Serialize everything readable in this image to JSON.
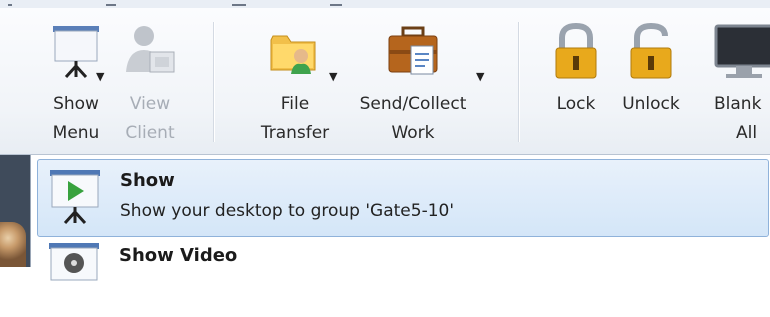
{
  "ribbon": {
    "show_menu": {
      "label_line1": "Show",
      "label_line2": "Menu",
      "icon": "presentation-screen-icon"
    },
    "view_client": {
      "label_line1": "View",
      "label_line2": "Client",
      "icon": "user-monitor-icon",
      "disabled": true
    },
    "file_transfer": {
      "label_line1": "File",
      "label_line2": "Transfer",
      "icon": "folder-user-icon"
    },
    "send_collect": {
      "label_line1": "Send/Collect",
      "label_line2": "Work",
      "icon": "briefcase-document-icon"
    },
    "lock": {
      "label_line1": "Lock",
      "icon": "padlock-closed-icon"
    },
    "unlock": {
      "label_line1": "Unlock",
      "icon": "padlock-open-icon"
    },
    "blank_all": {
      "label_line1": "Blank",
      "label_line2": "All",
      "icon": "monitor-icon"
    }
  },
  "menu": {
    "items": [
      {
        "title": "Show",
        "description": "Show your desktop to group 'Gate5-10'",
        "icon": "play-screen-icon",
        "highlighted": true
      },
      {
        "title": "Show Video",
        "icon": "film-reel-screen-icon"
      }
    ]
  },
  "colors": {
    "highlight": "#d4e6f8",
    "highlight_border": "#8fb2da",
    "lock_gold": "#e8a91c"
  }
}
